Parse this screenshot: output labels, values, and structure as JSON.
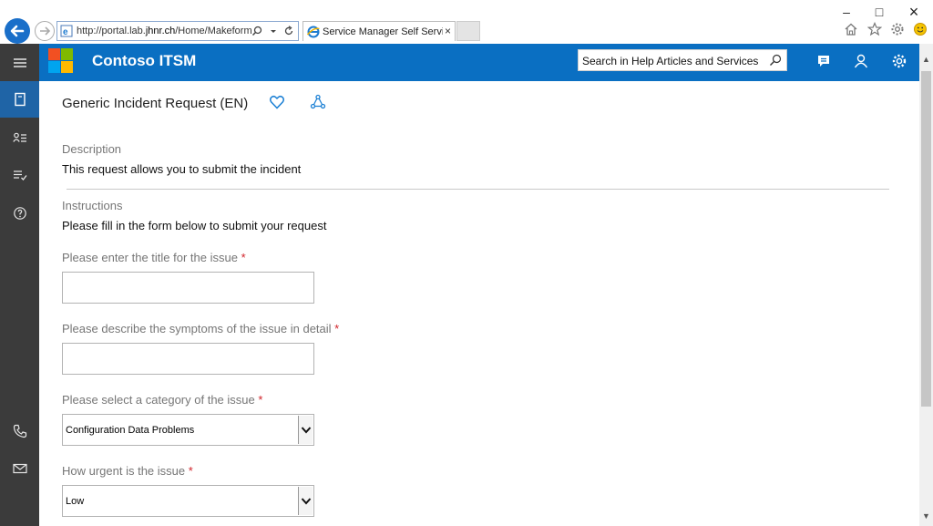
{
  "browser": {
    "url_prefix": "http://portal.lab.",
    "url_domain": "jhnr.ch",
    "url_suffix": "/Home/Makeform",
    "tab_title": "Service Manager Self Servic...",
    "tab_close": "×",
    "window_minimize": "–",
    "window_restore": "□",
    "window_close": "×"
  },
  "header": {
    "app_title": "Contoso ITSM",
    "search_placeholder": "Search in Help Articles and Services"
  },
  "sidenav": {
    "items": [
      {
        "name": "menu",
        "icon": "hamburger-icon"
      },
      {
        "name": "service-catalog",
        "icon": "book-icon",
        "active": true
      },
      {
        "name": "my-requests",
        "icon": "person-list-icon"
      },
      {
        "name": "my-activities",
        "icon": "checklist-icon"
      },
      {
        "name": "help",
        "icon": "help-icon"
      },
      {
        "name": "phone",
        "icon": "phone-icon"
      },
      {
        "name": "mail",
        "icon": "mail-icon"
      }
    ]
  },
  "page": {
    "title": "Generic Incident Request (EN)",
    "description_label": "Description",
    "description_text": "This request allows you to submit the incident",
    "instructions_label": "Instructions",
    "instructions_text": "Please fill in the form below to submit your request"
  },
  "form": {
    "required_marker": "*",
    "title_label": "Please enter the title for the issue",
    "title_value": "",
    "symptoms_label": "Please describe the symptoms of the issue in detail",
    "symptoms_value": "",
    "category_label": "Please select a category of the issue",
    "category_selected": "Configuration Data Problems",
    "urgency_label": "How urgent is the issue",
    "urgency_selected": "Low"
  },
  "colors": {
    "header_blue": "#0a6fc2",
    "sidenav_dark": "#3b3b3b",
    "sidenav_active": "#1f64a6",
    "required_red": "#d1232a"
  }
}
